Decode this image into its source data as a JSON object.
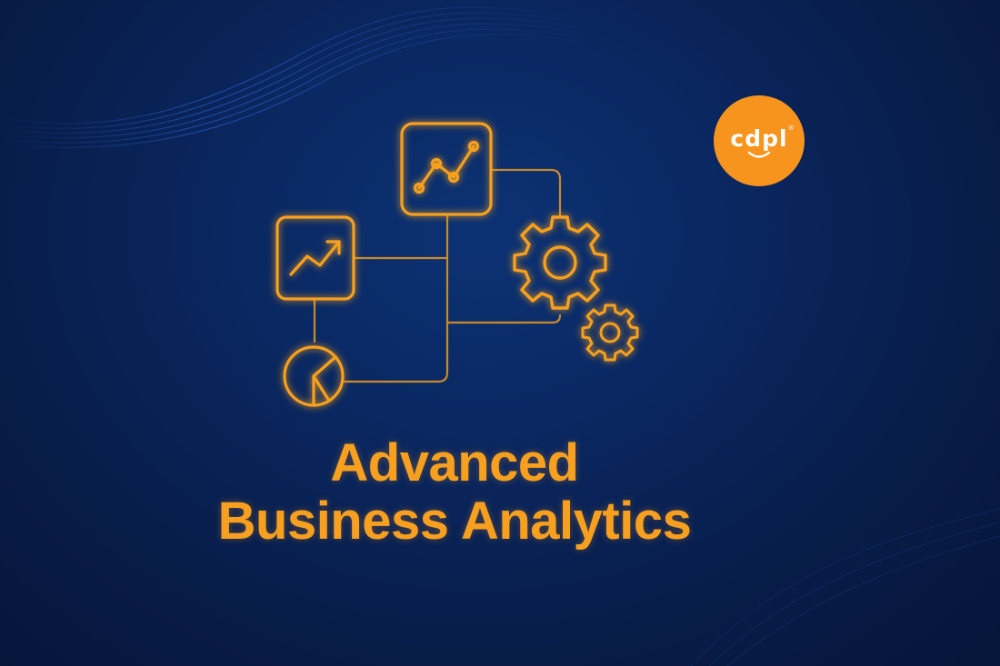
{
  "title": {
    "line1": "Advanced",
    "line2": "Business Analytics"
  },
  "logo": {
    "text": "cdpl",
    "registered_mark": "®",
    "color": "#f7941d"
  },
  "colors": {
    "accent": "#f7a01f",
    "background": "#0a2760",
    "connector": "#c98a2a"
  },
  "icons": [
    "line-chart-icon",
    "trend-arrow-icon",
    "pie-chart-icon",
    "large-gear-icon",
    "small-gear-icon"
  ]
}
